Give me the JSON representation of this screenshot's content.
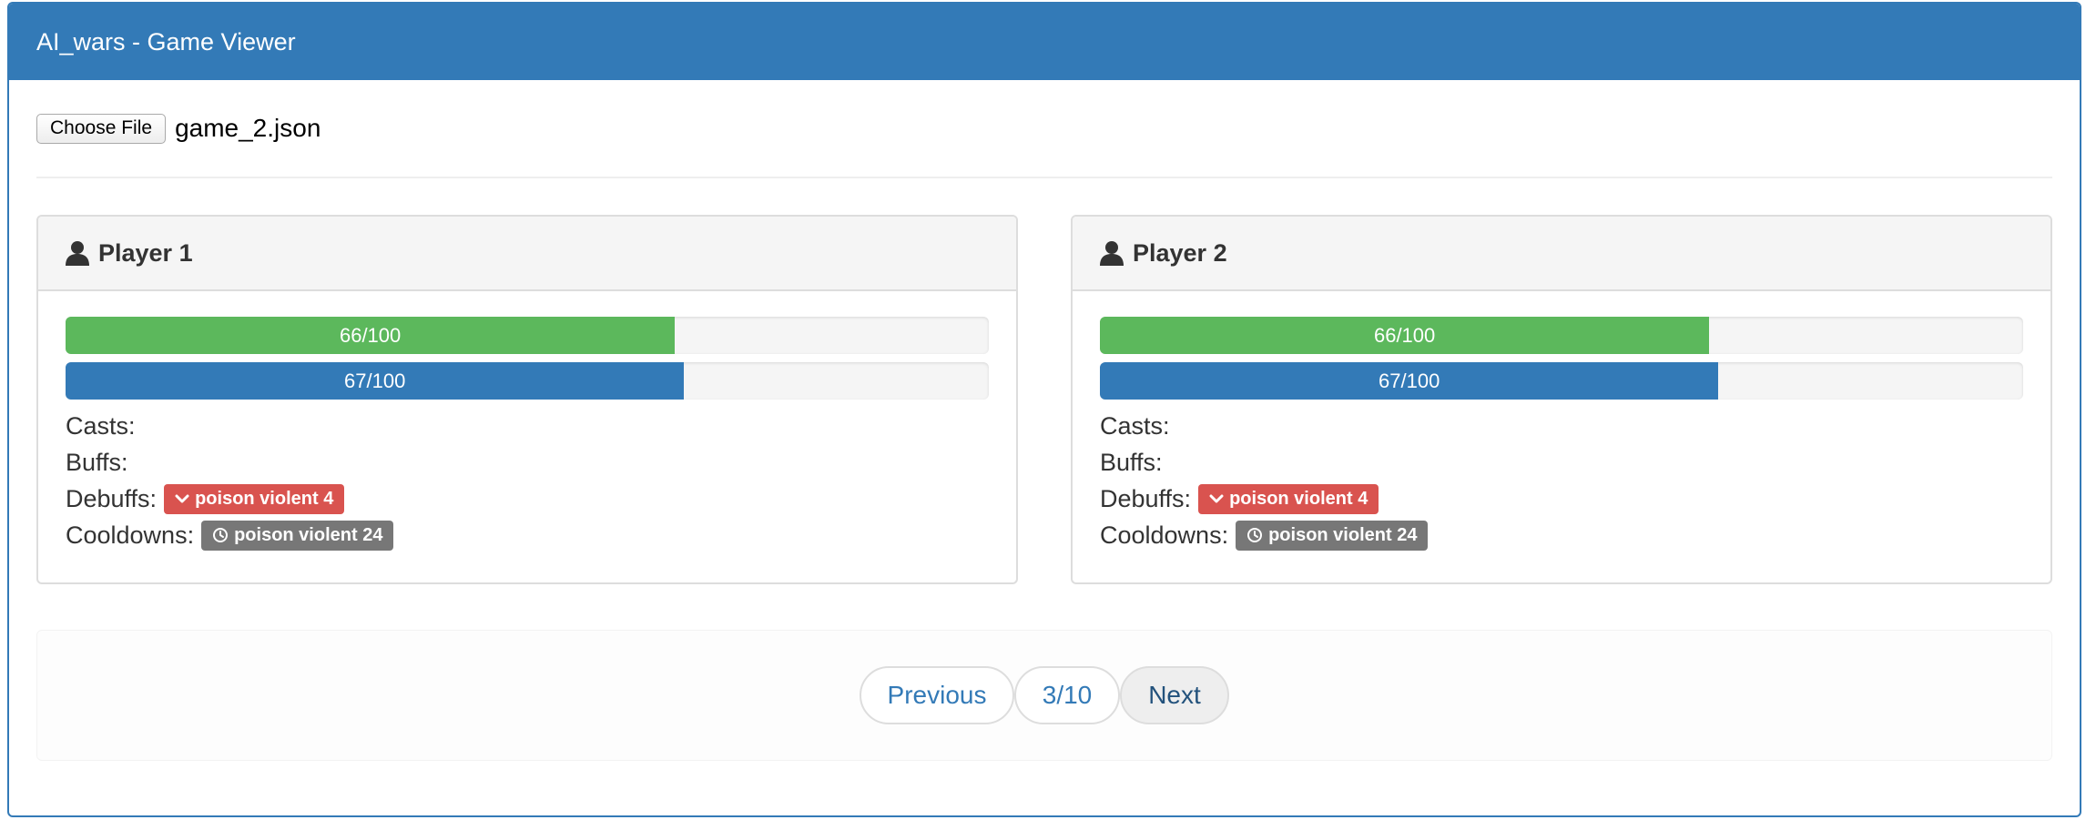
{
  "app": {
    "title": "AI_wars - Game Viewer"
  },
  "file": {
    "button_label": "Choose File",
    "file_name": "game_2.json"
  },
  "players": [
    {
      "name": "Player 1",
      "hp": {
        "text": "66/100",
        "fraction": 0.66
      },
      "mana": {
        "text": "67/100",
        "fraction": 0.67
      },
      "casts_label": "Casts:",
      "buffs_label": "Buffs:",
      "debuffs_label": "Debuffs:",
      "debuffs": [
        "poison violent 4"
      ],
      "cooldowns_label": "Cooldowns:",
      "cooldowns": [
        "poison violent 24"
      ]
    },
    {
      "name": "Player 2",
      "hp": {
        "text": "66/100",
        "fraction": 0.66
      },
      "mana": {
        "text": "67/100",
        "fraction": 0.67
      },
      "casts_label": "Casts:",
      "buffs_label": "Buffs:",
      "debuffs_label": "Debuffs:",
      "debuffs": [
        "poison violent 4"
      ],
      "cooldowns_label": "Cooldowns:",
      "cooldowns": [
        "poison violent 24"
      ]
    }
  ],
  "pager": {
    "previous_label": "Previous",
    "page_label": "3/10",
    "next_label": "Next"
  },
  "colors": {
    "header": "#337ab7",
    "hp_bar": "#5cb85c",
    "mana_bar": "#337ab7",
    "debuff_badge": "#d9534f",
    "cooldown_badge": "#777777"
  },
  "icons": {
    "player": "user-icon",
    "debuff": "chevron-down-icon",
    "cooldown": "clock-icon"
  }
}
